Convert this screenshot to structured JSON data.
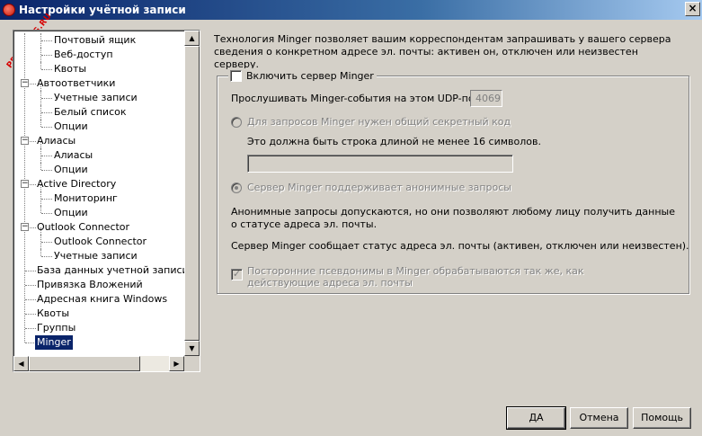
{
  "window": {
    "title": "Настройки учётной записи",
    "close_glyph": "×",
    "watermark": "PRODMAG.RU"
  },
  "tree": {
    "items": [
      {
        "label": "Почтовый ящик",
        "level": 2
      },
      {
        "label": "Веб-доступ",
        "level": 2
      },
      {
        "label": "Квоты",
        "level": 2
      },
      {
        "label": "Автоответчики",
        "level": 1,
        "expander": "−"
      },
      {
        "label": "Учетные записи",
        "level": 2
      },
      {
        "label": "Белый список",
        "level": 2
      },
      {
        "label": "Опции",
        "level": 2
      },
      {
        "label": "Алиасы",
        "level": 1,
        "expander": "−"
      },
      {
        "label": "Алиасы",
        "level": 2
      },
      {
        "label": "Опции",
        "level": 2
      },
      {
        "label": "Active Directory",
        "level": 1,
        "expander": "−"
      },
      {
        "label": "Мониторинг",
        "level": 2
      },
      {
        "label": "Опции",
        "level": 2
      },
      {
        "label": "Outlook Connector",
        "level": 1,
        "expander": "−"
      },
      {
        "label": "Outlook Connector",
        "level": 2
      },
      {
        "label": "Учетные записи",
        "level": 2
      },
      {
        "label": "База данных учетной записи",
        "level": 1
      },
      {
        "label": "Привязка Вложений",
        "level": 1
      },
      {
        "label": "Адресная книга Windows",
        "level": 1
      },
      {
        "label": "Квоты",
        "level": 1
      },
      {
        "label": "Группы",
        "level": 1
      },
      {
        "label": "Minger",
        "level": 1,
        "selected": true
      }
    ],
    "scroll_up": "▲",
    "scroll_down": "▼",
    "scroll_left": "◀",
    "scroll_right": "▶"
  },
  "panel": {
    "description": "Технология Minger позволяет вашим корреспондентам запрашивать у вашего сервера сведения о конкретном адресе эл. почты: активен он, отключен или неизвестен серверу.",
    "enable_label": "Включить сервер Minger",
    "port_label": "Прослушивать Minger-события на этом UDP-порте",
    "port_value": "4069",
    "shared_secret_label": "Для запросов Minger нужен общий секретный код",
    "secret_hint": "Это должна быть строка длиной не менее 16 символов.",
    "secret_value": "",
    "anonymous_label": "Сервер Minger поддерживает анонимные запросы",
    "anonymous_note": "Анонимные запросы допускаются, но они позволяют любому лицу получить данные о статусе адреса эл. почты.",
    "status_note": "Сервер Minger сообщает статус адреса эл. почты (активен, отключен или неизвестен).",
    "aliases_label": "Посторонние псевдонимы в Minger обрабатываются так же, как действующие адреса эл. почты",
    "check_glyph": "✓"
  },
  "buttons": {
    "ok": "ДА",
    "cancel": "Отмена",
    "help": "Помощь"
  }
}
